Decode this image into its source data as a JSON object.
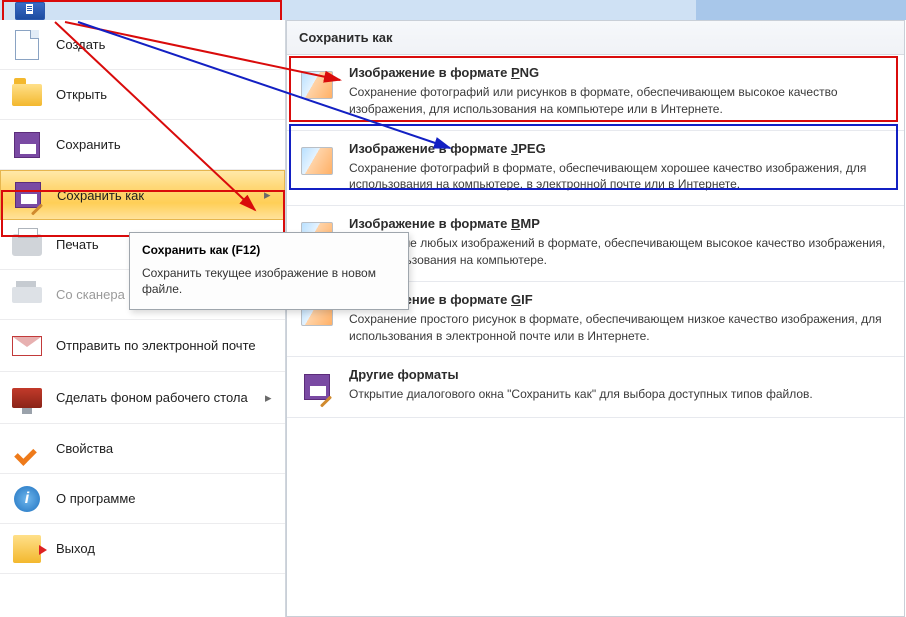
{
  "titlebar": {},
  "menu": {
    "items": [
      {
        "label": "Создать"
      },
      {
        "label": "Открыть"
      },
      {
        "label": "Сохранить"
      },
      {
        "label": "Сохранить как"
      },
      {
        "label": "Печать"
      },
      {
        "label": "Со сканера или камеры"
      },
      {
        "label": "Отправить по электронной почте"
      },
      {
        "label": "Сделать фоном рабочего стола"
      },
      {
        "label": "Свойства"
      },
      {
        "label": "О программе"
      },
      {
        "label": "Выход"
      }
    ]
  },
  "tooltip": {
    "title": "Сохранить как (F12)",
    "body": "Сохранить текущее изображение в новом файле."
  },
  "submenu": {
    "header": "Сохранить как",
    "options": [
      {
        "title_pre": "Изображение в формате ",
        "title_u": "P",
        "title_post": "NG",
        "desc": "Сохранение фотографий или рисунков в формате, обеспечивающем высокое качество изображения, для использования на компьютере или в Интернете."
      },
      {
        "title_pre": "Изображение в формате ",
        "title_u": "J",
        "title_post": "PEG",
        "desc": "Сохранение фотографий в формате, обеспечивающем хорошее качество изображения, для использования на компьютере, в электронной почте или в Интернете."
      },
      {
        "title_pre": "Изображение в формате ",
        "title_u": "B",
        "title_post": "MP",
        "desc": "Сохранение любых изображений в формате, обеспечивающем высокое качество изображения, для использования на компьютере."
      },
      {
        "title_pre": "Изображение в формате ",
        "title_u": "G",
        "title_post": "IF",
        "desc": "Сохранение простого рисунок в формате, обеспечивающем низкое качество изображения, для использования в электронной почте или в Интернете."
      },
      {
        "title_pre": "",
        "title_u": "Д",
        "title_post": "ругие форматы",
        "desc": "Открытие диалогового окна \"Сохранить как\" для выбора доступных типов файлов."
      }
    ]
  }
}
